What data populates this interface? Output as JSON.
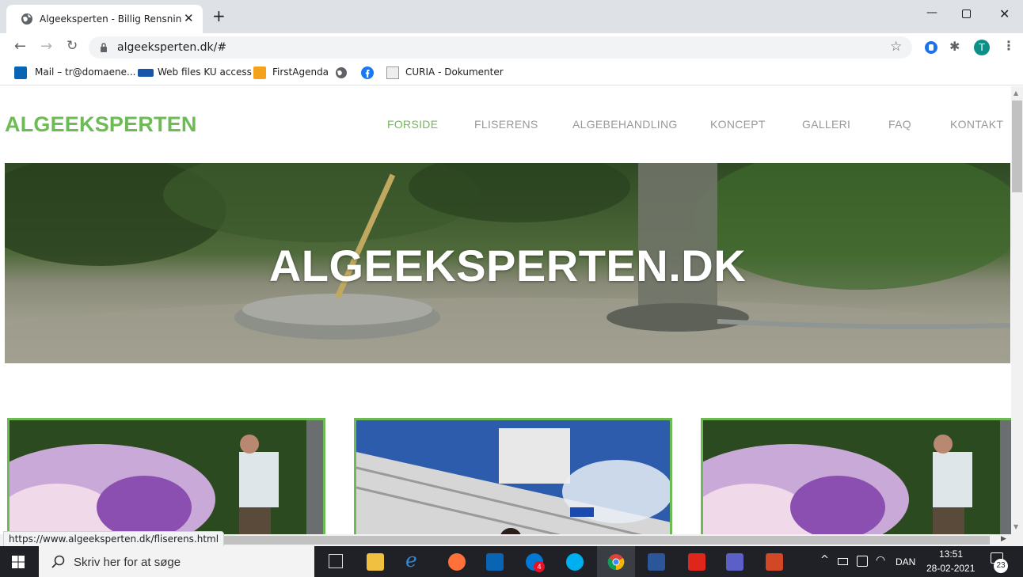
{
  "browser": {
    "tab_title": "Algeeksperten - Billig Rensning a",
    "url": "algeeksperten.dk/#",
    "bookmarks": [
      "Mail – tr@domaene...",
      "Web files KU access",
      "FirstAgenda",
      "CURIA - Dokumenter"
    ],
    "profile_initial": "T"
  },
  "site": {
    "logo": "ALGEEKSPERTEN",
    "nav": [
      "FORSIDE",
      "FLISERENS",
      "ALGEBEHANDLING",
      "KONCEPT",
      "GALLERI",
      "FAQ",
      "KONTAKT"
    ],
    "active_nav": "FORSIDE",
    "hero_title": "ALGEEKSPERTEN.DK"
  },
  "status_url": "https://www.algeeksperten.dk/fliserens.html",
  "taskbar": {
    "search_placeholder": "Skriv her for at søge",
    "language": "DAN",
    "time": "13:51",
    "date": "28-02-2021",
    "notification_count": "23",
    "skype_badge": "4"
  },
  "colors": {
    "brand_green": "#6dbb54",
    "nav_gray": "#999999",
    "tabbar": "#dee1e6",
    "taskbar": "#1f2126"
  }
}
